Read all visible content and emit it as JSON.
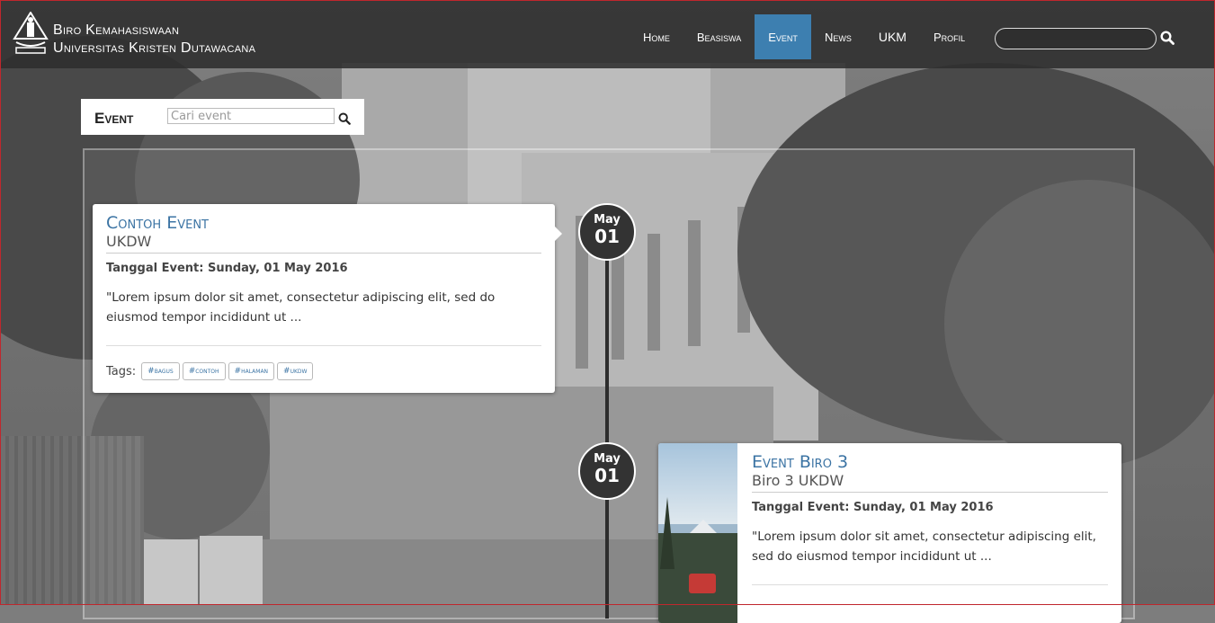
{
  "brand": {
    "line1": "Biro Kemahasiswaan",
    "line2": "Universitas Kristen Dutawacana"
  },
  "nav": {
    "items": [
      {
        "label": "Home"
      },
      {
        "label": "Beasiswa"
      },
      {
        "label": "Event"
      },
      {
        "label": "News"
      },
      {
        "label": "UKM"
      },
      {
        "label": "Profil"
      }
    ],
    "active": "Event"
  },
  "top_search": {
    "value": "",
    "icon": "search-icon"
  },
  "event_panel": {
    "title": "Event",
    "placeholder": "Cari event"
  },
  "events": [
    {
      "month": "May",
      "day": "01",
      "title": "Contoh Event",
      "subtitle": "UKDW",
      "date_text": "Tanggal Event: Sunday, 01 May 2016",
      "description": "\"Lorem ipsum dolor sit amet, consectetur adipiscing elit, sed do eiusmod tempor incididunt ut ...",
      "tags_label": "Tags:",
      "tags": [
        "#bagus",
        "#contoh",
        "#halaman",
        "#ukdw"
      ]
    },
    {
      "month": "May",
      "day": "01",
      "title": "Event Biro 3",
      "subtitle": "Biro 3 UKDW",
      "date_text": "Tanggal Event: Sunday, 01 May 2016",
      "description": "\"Lorem ipsum dolor sit amet, consectetur adipiscing elit, sed do eiusmod tempor incididunt ut ..."
    }
  ],
  "colors": {
    "accent": "#3d7fb0",
    "header_bg": "#2d2d2d",
    "title_blue": "#3c74a4"
  }
}
